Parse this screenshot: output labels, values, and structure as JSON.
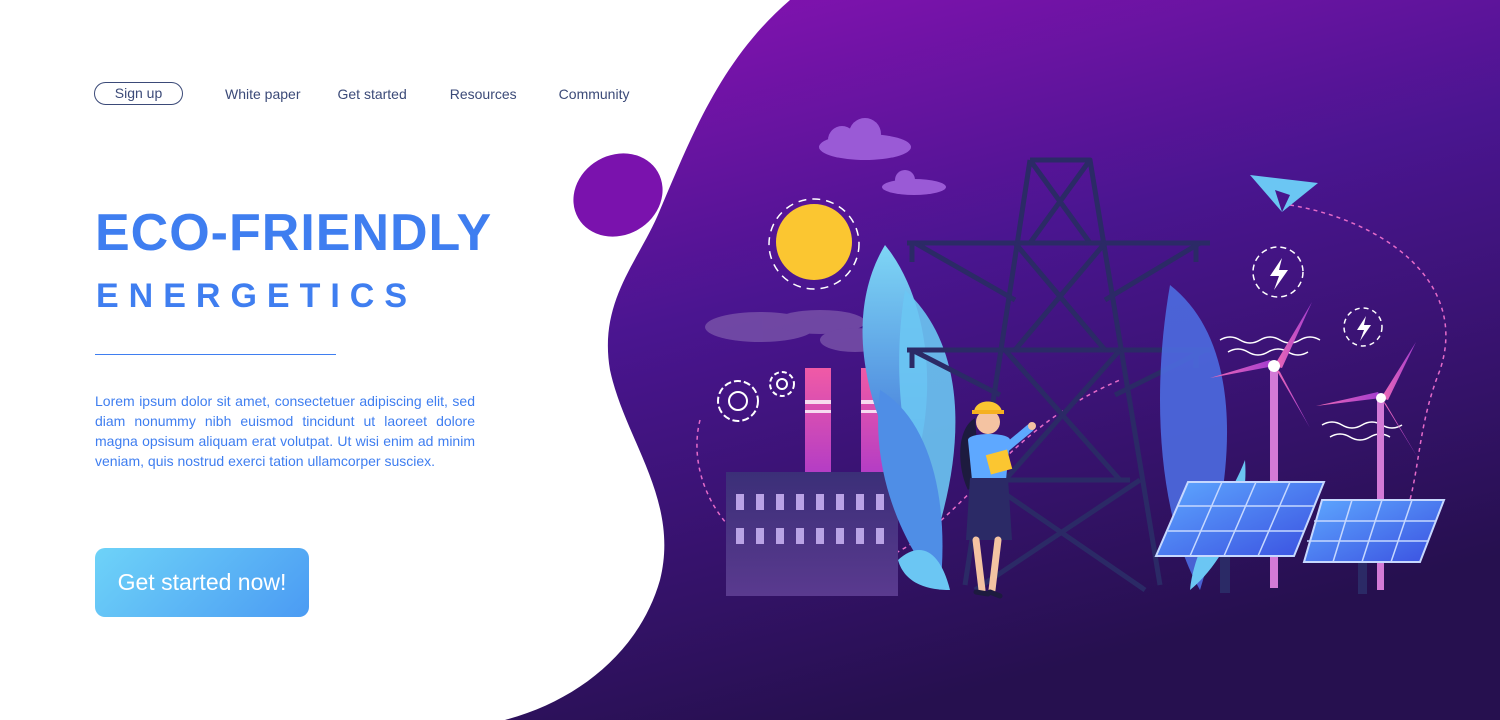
{
  "nav": {
    "signup_label": "Sign up",
    "links": [
      "White paper",
      "Get started",
      "Resources",
      "Community"
    ]
  },
  "hero": {
    "title": "ECO-FRIENDLY",
    "subtitle": "ENERGETICS",
    "body": "Lorem ipsum dolor sit amet, consectetuer adipiscing elit, sed diam nonummy nibh euismod tincidunt ut laoreet dolore magna opsisum aliquam erat volutpat. Ut wisi enim ad minim veniam, quis nostrud exerci tation ullamcorper susciex.",
    "cta_label": "Get started now!"
  },
  "colors": {
    "accent": "#3f7ef0",
    "nav_text": "#3b4a78",
    "blob_top": "#8a12b4",
    "blob_bottom": "#2a1055",
    "cta_start": "#6ed3f8",
    "cta_end": "#4b9bf3"
  },
  "illustration": {
    "icons": [
      "cloud-icon",
      "sun-icon",
      "gear-icon",
      "factory-icon",
      "leaf-icon",
      "transmission-tower-icon",
      "engineer-woman-icon",
      "paper-plane-icon",
      "lightning-icon",
      "wind-turbine-icon",
      "solar-panel-icon"
    ]
  }
}
